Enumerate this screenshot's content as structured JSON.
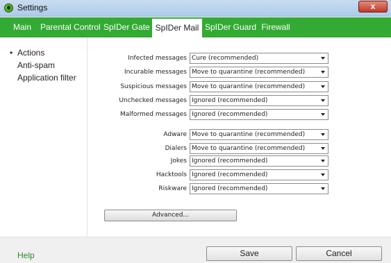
{
  "window": {
    "title": "Settings",
    "close_label": "x"
  },
  "tabs": [
    {
      "label": "Main"
    },
    {
      "label": "Parental Control"
    },
    {
      "label": "SpIDer Gate"
    },
    {
      "label": "SpIDer Mail",
      "active": true
    },
    {
      "label": "SpIDer Guard"
    },
    {
      "label": "Firewall"
    }
  ],
  "sidebar": {
    "bullet": "•",
    "items": [
      {
        "label": "Actions",
        "selected": true
      },
      {
        "label": "Anti-spam"
      },
      {
        "label": "Application filter"
      }
    ]
  },
  "actions": {
    "rows": [
      {
        "label": "Infected messages",
        "value": "Cure (recommended)"
      },
      {
        "label": "Incurable messages",
        "value": "Move to quarantine (recommended)"
      },
      {
        "label": "Suspicious messages",
        "value": "Move to quarantine (recommended)"
      },
      {
        "label": "Unchecked messages",
        "value": "Ignored (recommended)"
      },
      {
        "label": "Malformed messages",
        "value": "Ignored (recommended)"
      },
      {
        "label": "Adware",
        "value": "Move to quarantine (recommended)"
      },
      {
        "label": "Dialers",
        "value": "Move to quarantine (recommended)"
      },
      {
        "label": "Jokes",
        "value": "Ignored (recommended)"
      },
      {
        "label": "Hacktools",
        "value": "Ignored (recommended)"
      },
      {
        "label": "Riskware",
        "value": "Ignored (recommended)"
      }
    ],
    "advanced_label": "Advanced..."
  },
  "footer": {
    "help_label": "Help",
    "save_label": "Save",
    "cancel_label": "Cancel"
  },
  "colors": {
    "tab_bar": "#33aa33",
    "help_link": "#2a8a2a"
  }
}
